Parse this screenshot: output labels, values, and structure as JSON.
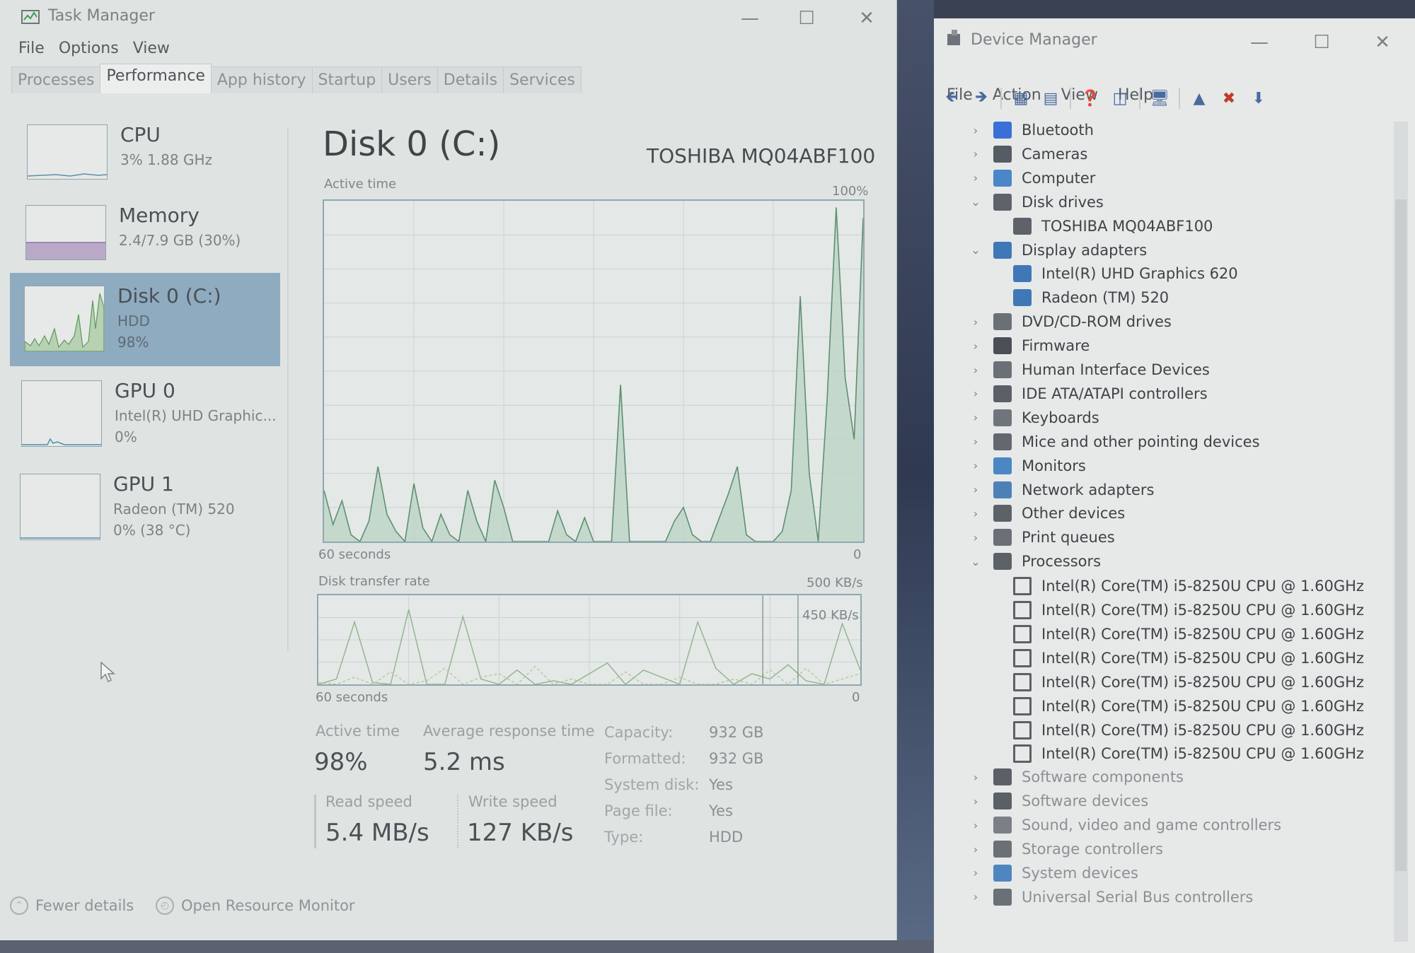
{
  "task_manager": {
    "title": "Task Manager",
    "menus": [
      "File",
      "Options",
      "View"
    ],
    "tabs": [
      "Processes",
      "Performance",
      "App history",
      "Startup",
      "Users",
      "Details",
      "Services"
    ],
    "active_tab": "Performance",
    "resources": [
      {
        "name": "CPU",
        "line1": "3%  1.88 GHz",
        "line2": ""
      },
      {
        "name": "Memory",
        "line1": "2.4/7.9 GB (30%)",
        "line2": ""
      },
      {
        "name": "Disk 0 (C:)",
        "line1": "HDD",
        "line2": "98%"
      },
      {
        "name": "GPU 0",
        "line1": "Intel(R) UHD Graphic...",
        "line2": "0%"
      },
      {
        "name": "GPU 1",
        "line1": "Radeon (TM) 520",
        "line2": "0% (38 °C)"
      }
    ],
    "detail": {
      "title": "Disk 0 (C:)",
      "model": "TOSHIBA MQ04ABF100",
      "graph1_label": "Active time",
      "graph1_max": "100%",
      "graph1_left": "60 seconds",
      "graph1_right": "0",
      "graph2_label": "Disk transfer rate",
      "graph2_max": "500 KB/s",
      "graph2_inner": "450 KB/s",
      "graph2_left": "60 seconds",
      "graph2_right": "0",
      "stats": {
        "active_time_label": "Active time",
        "active_time_value": "98%",
        "avg_resp_label": "Average response time",
        "avg_resp_value": "5.2 ms",
        "read_label": "Read speed",
        "read_value": "5.4 MB/s",
        "write_label": "Write speed",
        "write_value": "127 KB/s"
      },
      "props": [
        {
          "label": "Capacity:",
          "value": "932 GB"
        },
        {
          "label": "Formatted:",
          "value": "932 GB"
        },
        {
          "label": "System disk:",
          "value": "Yes"
        },
        {
          "label": "Page file:",
          "value": "Yes"
        },
        {
          "label": "Type:",
          "value": "HDD"
        }
      ]
    },
    "footer": {
      "fewer_details": "Fewer details",
      "open_monitor": "Open Resource Monitor"
    }
  },
  "device_manager": {
    "title": "Device Manager",
    "menus": [
      "File",
      "Action",
      "View",
      "Help"
    ],
    "tree": [
      {
        "label": "Bluetooth",
        "level": 0,
        "state": "collapsed",
        "color": "#3b6fd8"
      },
      {
        "label": "Cameras",
        "level": 0,
        "state": "collapsed",
        "color": "#555c63"
      },
      {
        "label": "Computer",
        "level": 0,
        "state": "collapsed",
        "color": "#4a86c8"
      },
      {
        "label": "Disk drives",
        "level": 0,
        "state": "expanded",
        "color": "#5d6369"
      },
      {
        "label": "TOSHIBA MQ04ABF100",
        "level": 1,
        "state": "leaf",
        "color": "#5d6369"
      },
      {
        "label": "Display adapters",
        "level": 0,
        "state": "expanded",
        "color": "#3f78b6"
      },
      {
        "label": "Intel(R) UHD Graphics 620",
        "level": 1,
        "state": "leaf",
        "color": "#3f78b6"
      },
      {
        "label": "Radeon (TM) 520",
        "level": 1,
        "state": "leaf",
        "color": "#3f78b6"
      },
      {
        "label": "DVD/CD-ROM drives",
        "level": 0,
        "state": "collapsed",
        "color": "#6a7076"
      },
      {
        "label": "Firmware",
        "level": 0,
        "state": "collapsed",
        "color": "#4a4f55"
      },
      {
        "label": "Human Interface Devices",
        "level": 0,
        "state": "collapsed",
        "color": "#6b7077"
      },
      {
        "label": "IDE ATA/ATAPI controllers",
        "level": 0,
        "state": "collapsed",
        "color": "#5a6066"
      },
      {
        "label": "Keyboards",
        "level": 0,
        "state": "collapsed",
        "color": "#6f757b"
      },
      {
        "label": "Mice and other pointing devices",
        "level": 0,
        "state": "collapsed",
        "color": "#62686e"
      },
      {
        "label": "Monitors",
        "level": 0,
        "state": "collapsed",
        "color": "#4b87c4"
      },
      {
        "label": "Network adapters",
        "level": 0,
        "state": "collapsed",
        "color": "#4e80b8"
      },
      {
        "label": "Other devices",
        "level": 0,
        "state": "collapsed",
        "color": "#5c6268"
      },
      {
        "label": "Print queues",
        "level": 0,
        "state": "collapsed",
        "color": "#6a7076"
      },
      {
        "label": "Processors",
        "level": 0,
        "state": "expanded",
        "color": "#5b6167"
      },
      {
        "label": "Intel(R) Core(TM) i5-8250U CPU @ 1.60GHz",
        "level": 1,
        "state": "leaf",
        "color": "#5b6167"
      },
      {
        "label": "Intel(R) Core(TM) i5-8250U CPU @ 1.60GHz",
        "level": 1,
        "state": "leaf",
        "color": "#5b6167"
      },
      {
        "label": "Intel(R) Core(TM) i5-8250U CPU @ 1.60GHz",
        "level": 1,
        "state": "leaf",
        "color": "#5b6167"
      },
      {
        "label": "Intel(R) Core(TM) i5-8250U CPU @ 1.60GHz",
        "level": 1,
        "state": "leaf",
        "color": "#5b6167"
      },
      {
        "label": "Intel(R) Core(TM) i5-8250U CPU @ 1.60GHz",
        "level": 1,
        "state": "leaf",
        "color": "#5b6167"
      },
      {
        "label": "Intel(R) Core(TM) i5-8250U CPU @ 1.60GHz",
        "level": 1,
        "state": "leaf",
        "color": "#5b6167"
      },
      {
        "label": "Intel(R) Core(TM) i5-8250U CPU @ 1.60GHz",
        "level": 1,
        "state": "leaf",
        "color": "#5b6167"
      },
      {
        "label": "Intel(R) Core(TM) i5-8250U CPU @ 1.60GHz",
        "level": 1,
        "state": "leaf",
        "color": "#5b6167"
      },
      {
        "label": "Software components",
        "level": 0,
        "state": "collapsed",
        "color": "#5a6066"
      },
      {
        "label": "Software devices",
        "level": 0,
        "state": "collapsed",
        "color": "#5a6066"
      },
      {
        "label": "Sound, video and game controllers",
        "level": 0,
        "state": "collapsed",
        "color": "#7a8086"
      },
      {
        "label": "Storage controllers",
        "level": 0,
        "state": "collapsed",
        "color": "#6a7076"
      },
      {
        "label": "System devices",
        "level": 0,
        "state": "collapsed",
        "color": "#4f86bf"
      },
      {
        "label": "Universal Serial Bus controllers",
        "level": 0,
        "state": "collapsed",
        "color": "#6a7076"
      }
    ]
  },
  "chart_data": [
    {
      "type": "area",
      "title": "Active time",
      "ylim": [
        0,
        100
      ],
      "x": [
        60,
        59,
        58,
        57,
        56,
        55,
        54,
        53,
        52,
        51,
        50,
        49,
        48,
        47,
        46,
        45,
        44,
        43,
        42,
        41,
        40,
        39,
        38,
        37,
        36,
        35,
        34,
        33,
        32,
        31,
        30,
        29,
        28,
        27,
        26,
        25,
        24,
        23,
        22,
        21,
        20,
        19,
        18,
        17,
        16,
        15,
        14,
        13,
        12,
        11,
        10,
        9,
        8,
        7,
        6,
        5,
        4,
        3,
        2,
        1,
        0
      ],
      "values": [
        15,
        5,
        12,
        2,
        0,
        6,
        22,
        8,
        3,
        0,
        17,
        4,
        0,
        8,
        2,
        0,
        15,
        6,
        0,
        18,
        10,
        0,
        0,
        0,
        0,
        0,
        9,
        2,
        0,
        7,
        0,
        0,
        0,
        46,
        0,
        0,
        0,
        0,
        0,
        6,
        10,
        2,
        0,
        0,
        7,
        14,
        22,
        2,
        0,
        0,
        0,
        3,
        15,
        72,
        20,
        0,
        42,
        98,
        48,
        30,
        95
      ],
      "xlabel": "60 seconds",
      "ylabel": ""
    },
    {
      "type": "line",
      "title": "Disk transfer rate",
      "ylim": [
        0,
        500
      ],
      "x": [
        60,
        58,
        56,
        54,
        52,
        50,
        48,
        46,
        44,
        42,
        40,
        38,
        36,
        34,
        32,
        30,
        28,
        26,
        24,
        22,
        20,
        18,
        16,
        14,
        12,
        10,
        8,
        6,
        4,
        2,
        0
      ],
      "series": [
        {
          "values": [
            0,
            30,
            350,
            10,
            0,
            420,
            0,
            0,
            380,
            30,
            0,
            80,
            0,
            20,
            0,
            60,
            120,
            0,
            80,
            40,
            0,
            350,
            90,
            0,
            60,
            30,
            110,
            20,
            0,
            340,
            80
          ]
        },
        {
          "values": [
            10,
            0,
            40,
            0,
            70,
            0,
            20,
            90,
            0,
            40,
            60,
            0,
            100,
            0,
            30,
            0,
            0,
            70,
            0,
            0,
            40,
            0,
            0,
            30,
            0,
            80,
            0,
            90,
            0,
            30,
            60
          ]
        }
      ],
      "xlabel": "60 seconds",
      "ylabel": ""
    }
  ]
}
